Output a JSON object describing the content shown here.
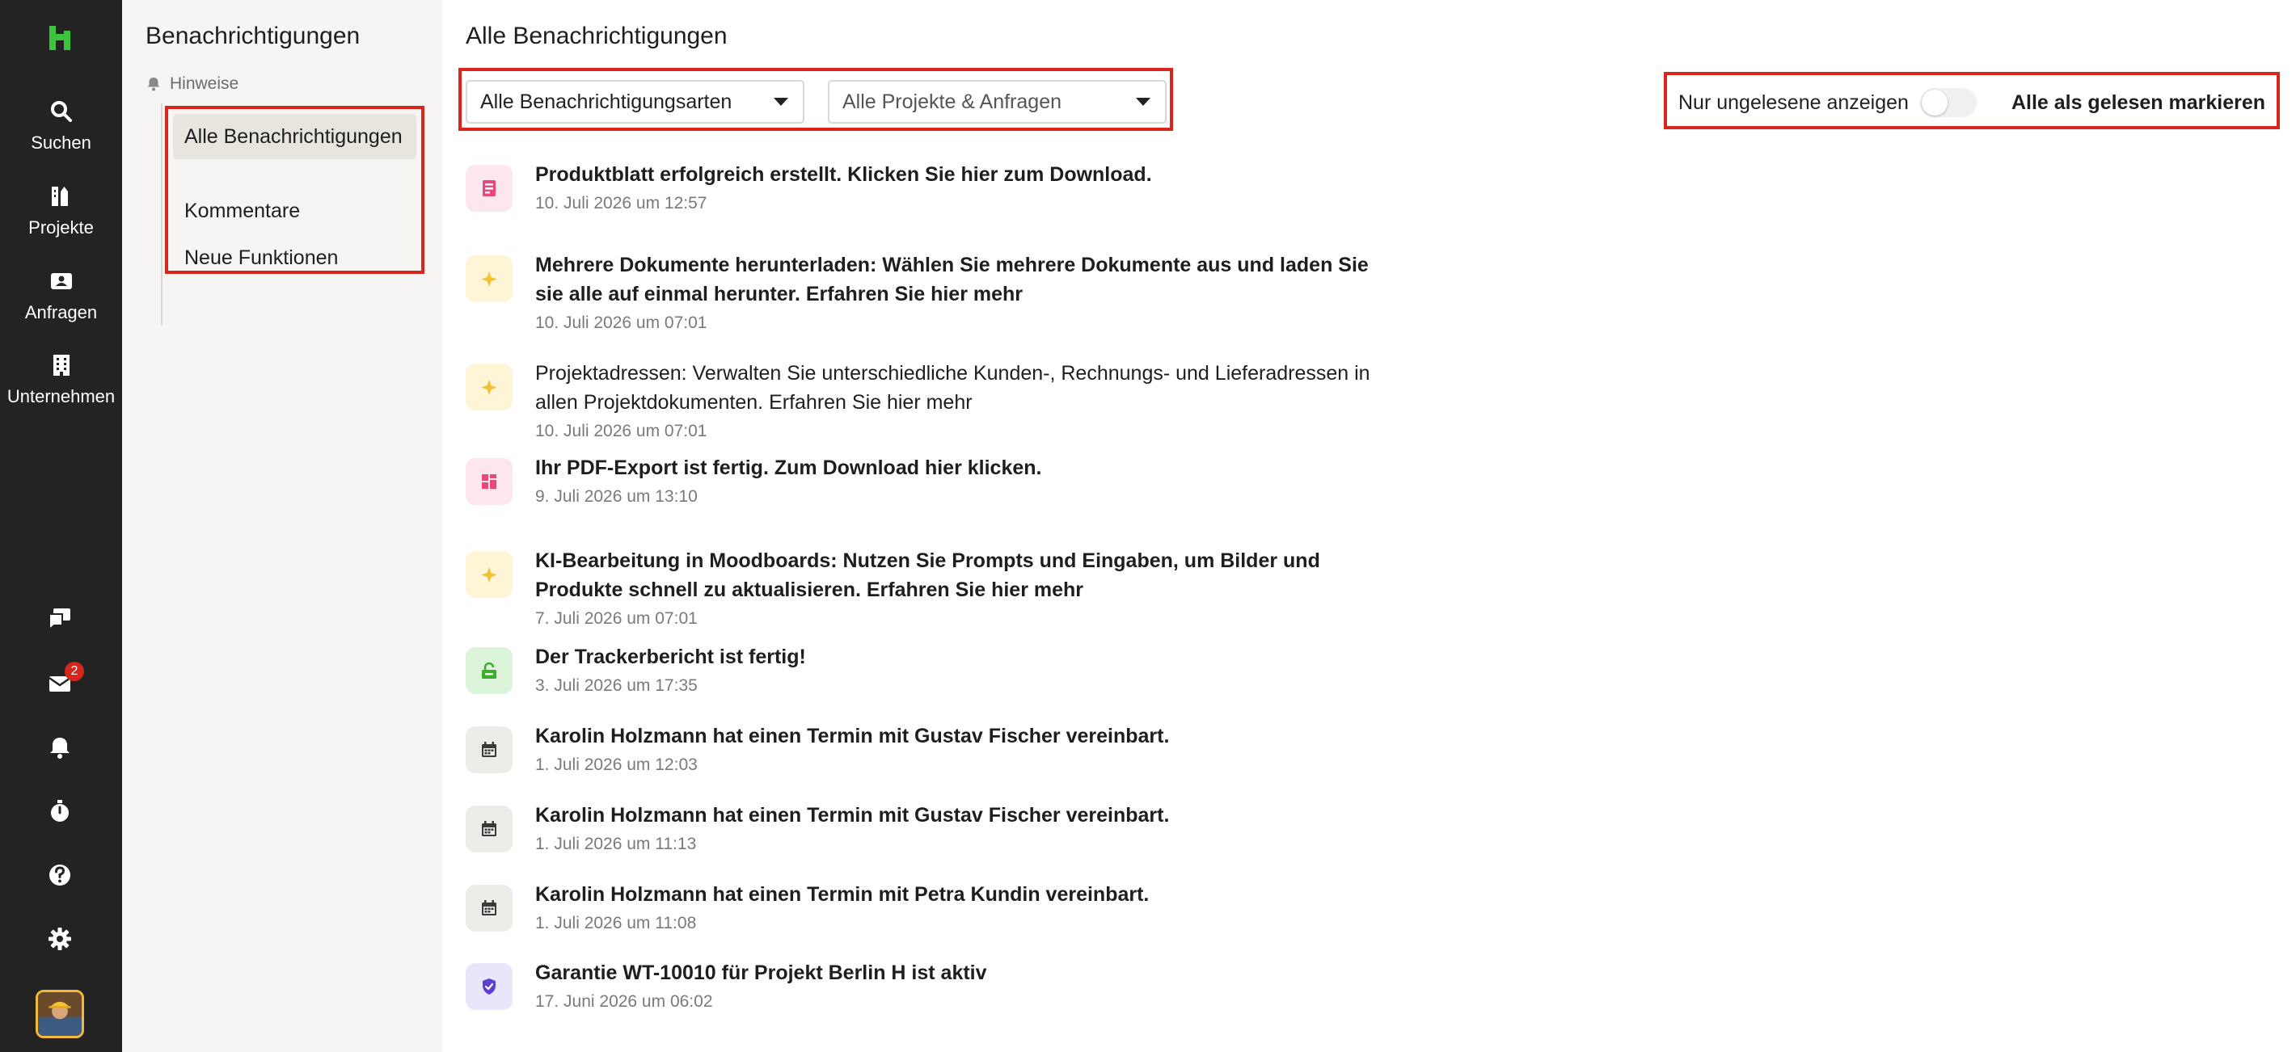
{
  "colors": {
    "rail_bg": "#232323",
    "accent_green": "#3cc43c",
    "highlight_red": "#d9261c",
    "sidebar_bg": "#f6f5f3"
  },
  "rail": {
    "logo": "h-logo-icon",
    "nav": [
      {
        "label": "Suchen",
        "icon": "search-icon"
      },
      {
        "label": "Projekte",
        "icon": "projects-icon"
      },
      {
        "label": "Anfragen",
        "icon": "inquiries-icon"
      },
      {
        "label": "Unternehmen",
        "icon": "building-icon"
      }
    ],
    "bottom_icons": [
      "chat-icon",
      "inbox-icon",
      "bell-icon",
      "stopwatch-icon",
      "help-icon",
      "gear-icon"
    ],
    "mail_badge": "2"
  },
  "sidebar": {
    "title": "Benachrichtigungen",
    "section": "Hinweise",
    "items": [
      {
        "label": "Alle Benachrichtigungen",
        "active": true
      },
      {
        "label": "Kommentare",
        "active": false
      },
      {
        "label": "Neue Funktionen",
        "active": false
      }
    ]
  },
  "main": {
    "title": "Alle Benachrichtigungen",
    "filters": {
      "type": "Alle Benachrichtigungsarten",
      "project": "Alle Projekte & Anfragen"
    },
    "unread_label": "Nur ungelesene anzeigen",
    "unread_only": false,
    "mark_all_read": "Alle als gelesen markieren"
  },
  "notifications": [
    {
      "icon": "document-icon",
      "tone": "pink",
      "bold": true,
      "text": "Produktblatt erfolgreich erstellt. Klicken Sie hier zum Download.",
      "date": "10. Juli 2026 um 12:57"
    },
    {
      "icon": "sparkle-icon",
      "tone": "yellow",
      "bold": true,
      "text": "Mehrere Dokumente herunterladen: Wählen Sie mehrere Dokumente aus und laden Sie sie alle auf einmal herunter. Erfahren Sie hier mehr",
      "date": "10. Juli 2026 um 07:01"
    },
    {
      "icon": "sparkle-icon",
      "tone": "yellow",
      "bold": false,
      "text": "Projektadressen: Verwalten Sie unterschiedliche Kunden-, Rechnungs- und Lieferadressen in allen Projektdokumenten. Erfahren Sie hier mehr",
      "date": "10. Juli 2026 um 07:01"
    },
    {
      "icon": "pdf-export-icon",
      "tone": "pink",
      "bold": true,
      "text": "Ihr PDF-Export ist fertig. Zum Download hier klicken.",
      "date": "9. Juli 2026 um 13:10"
    },
    {
      "icon": "sparkle-icon",
      "tone": "yellow",
      "bold": true,
      "text": "KI-Bearbeitung in Moodboards: Nutzen Sie Prompts und Eingaben, um Bilder und Produkte schnell zu aktualisieren. Erfahren Sie hier mehr",
      "date": "7. Juli 2026 um 07:01"
    },
    {
      "icon": "tracker-icon",
      "tone": "green",
      "bold": true,
      "text": "Der Trackerbericht ist fertig!",
      "date": "3. Juli 2026 um 17:35"
    },
    {
      "icon": "calendar-icon",
      "tone": "grey",
      "bold": true,
      "text": "Karolin Holzmann hat einen Termin mit Gustav Fischer vereinbart.",
      "date": "1. Juli 2026 um 12:03"
    },
    {
      "icon": "calendar-icon",
      "tone": "grey",
      "bold": true,
      "text": "Karolin Holzmann hat einen Termin mit Gustav Fischer vereinbart.",
      "date": "1. Juli 2026 um 11:13"
    },
    {
      "icon": "calendar-icon",
      "tone": "grey",
      "bold": true,
      "text": "Karolin Holzmann hat einen Termin mit Petra Kundin vereinbart.",
      "date": "1. Juli 2026 um 11:08"
    },
    {
      "icon": "shield-icon",
      "tone": "purple",
      "bold": true,
      "text": "Garantie WT-10010 für Projekt Berlin H ist aktiv",
      "date": "17. Juni 2026 um 06:02"
    }
  ]
}
